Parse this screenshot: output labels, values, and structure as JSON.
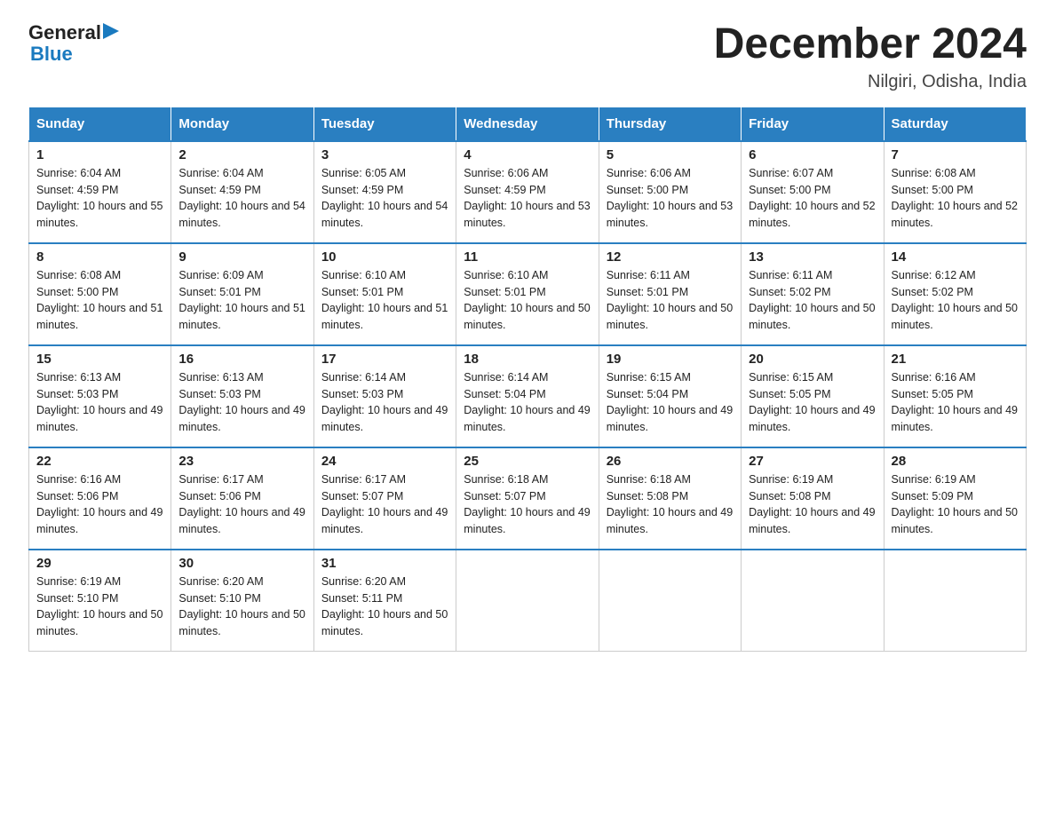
{
  "logo": {
    "general": "General",
    "blue": "Blue",
    "arrow": "▶"
  },
  "title": "December 2024",
  "subtitle": "Nilgiri, Odisha, India",
  "days_of_week": [
    "Sunday",
    "Monday",
    "Tuesday",
    "Wednesday",
    "Thursday",
    "Friday",
    "Saturday"
  ],
  "weeks": [
    [
      {
        "day": "1",
        "sunrise": "6:04 AM",
        "sunset": "4:59 PM",
        "daylight": "10 hours and 55 minutes."
      },
      {
        "day": "2",
        "sunrise": "6:04 AM",
        "sunset": "4:59 PM",
        "daylight": "10 hours and 54 minutes."
      },
      {
        "day": "3",
        "sunrise": "6:05 AM",
        "sunset": "4:59 PM",
        "daylight": "10 hours and 54 minutes."
      },
      {
        "day": "4",
        "sunrise": "6:06 AM",
        "sunset": "4:59 PM",
        "daylight": "10 hours and 53 minutes."
      },
      {
        "day": "5",
        "sunrise": "6:06 AM",
        "sunset": "5:00 PM",
        "daylight": "10 hours and 53 minutes."
      },
      {
        "day": "6",
        "sunrise": "6:07 AM",
        "sunset": "5:00 PM",
        "daylight": "10 hours and 52 minutes."
      },
      {
        "day": "7",
        "sunrise": "6:08 AM",
        "sunset": "5:00 PM",
        "daylight": "10 hours and 52 minutes."
      }
    ],
    [
      {
        "day": "8",
        "sunrise": "6:08 AM",
        "sunset": "5:00 PM",
        "daylight": "10 hours and 51 minutes."
      },
      {
        "day": "9",
        "sunrise": "6:09 AM",
        "sunset": "5:01 PM",
        "daylight": "10 hours and 51 minutes."
      },
      {
        "day": "10",
        "sunrise": "6:10 AM",
        "sunset": "5:01 PM",
        "daylight": "10 hours and 51 minutes."
      },
      {
        "day": "11",
        "sunrise": "6:10 AM",
        "sunset": "5:01 PM",
        "daylight": "10 hours and 50 minutes."
      },
      {
        "day": "12",
        "sunrise": "6:11 AM",
        "sunset": "5:01 PM",
        "daylight": "10 hours and 50 minutes."
      },
      {
        "day": "13",
        "sunrise": "6:11 AM",
        "sunset": "5:02 PM",
        "daylight": "10 hours and 50 minutes."
      },
      {
        "day": "14",
        "sunrise": "6:12 AM",
        "sunset": "5:02 PM",
        "daylight": "10 hours and 50 minutes."
      }
    ],
    [
      {
        "day": "15",
        "sunrise": "6:13 AM",
        "sunset": "5:03 PM",
        "daylight": "10 hours and 49 minutes."
      },
      {
        "day": "16",
        "sunrise": "6:13 AM",
        "sunset": "5:03 PM",
        "daylight": "10 hours and 49 minutes."
      },
      {
        "day": "17",
        "sunrise": "6:14 AM",
        "sunset": "5:03 PM",
        "daylight": "10 hours and 49 minutes."
      },
      {
        "day": "18",
        "sunrise": "6:14 AM",
        "sunset": "5:04 PM",
        "daylight": "10 hours and 49 minutes."
      },
      {
        "day": "19",
        "sunrise": "6:15 AM",
        "sunset": "5:04 PM",
        "daylight": "10 hours and 49 minutes."
      },
      {
        "day": "20",
        "sunrise": "6:15 AM",
        "sunset": "5:05 PM",
        "daylight": "10 hours and 49 minutes."
      },
      {
        "day": "21",
        "sunrise": "6:16 AM",
        "sunset": "5:05 PM",
        "daylight": "10 hours and 49 minutes."
      }
    ],
    [
      {
        "day": "22",
        "sunrise": "6:16 AM",
        "sunset": "5:06 PM",
        "daylight": "10 hours and 49 minutes."
      },
      {
        "day": "23",
        "sunrise": "6:17 AM",
        "sunset": "5:06 PM",
        "daylight": "10 hours and 49 minutes."
      },
      {
        "day": "24",
        "sunrise": "6:17 AM",
        "sunset": "5:07 PM",
        "daylight": "10 hours and 49 minutes."
      },
      {
        "day": "25",
        "sunrise": "6:18 AM",
        "sunset": "5:07 PM",
        "daylight": "10 hours and 49 minutes."
      },
      {
        "day": "26",
        "sunrise": "6:18 AM",
        "sunset": "5:08 PM",
        "daylight": "10 hours and 49 minutes."
      },
      {
        "day": "27",
        "sunrise": "6:19 AM",
        "sunset": "5:08 PM",
        "daylight": "10 hours and 49 minutes."
      },
      {
        "day": "28",
        "sunrise": "6:19 AM",
        "sunset": "5:09 PM",
        "daylight": "10 hours and 50 minutes."
      }
    ],
    [
      {
        "day": "29",
        "sunrise": "6:19 AM",
        "sunset": "5:10 PM",
        "daylight": "10 hours and 50 minutes."
      },
      {
        "day": "30",
        "sunrise": "6:20 AM",
        "sunset": "5:10 PM",
        "daylight": "10 hours and 50 minutes."
      },
      {
        "day": "31",
        "sunrise": "6:20 AM",
        "sunset": "5:11 PM",
        "daylight": "10 hours and 50 minutes."
      },
      null,
      null,
      null,
      null
    ]
  ]
}
